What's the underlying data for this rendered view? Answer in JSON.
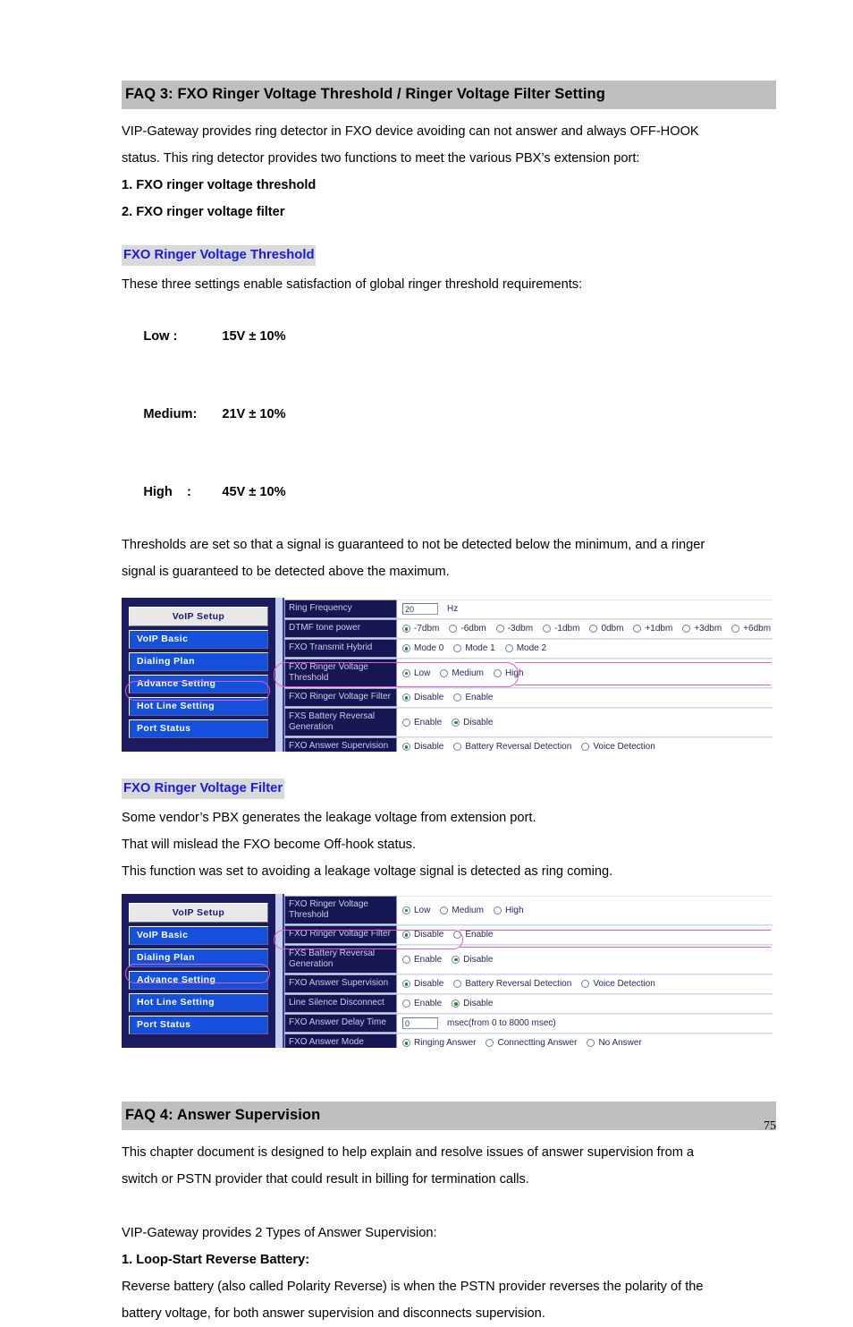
{
  "page": {
    "number": "75"
  },
  "faq3": {
    "banner": "FAQ 3: FXO Ringer Voltage Threshold / Ringer Voltage Filter Setting",
    "intro_line1": "VIP-Gateway provides ring detector in FXO device avoiding can not answer and always OFF-HOOK",
    "intro_line2": "status. This ring detector provides two functions to meet the various PBX’s extension port:",
    "list": [
      "1. FXO ringer voltage threshold",
      "2. FXO ringer voltage filter"
    ],
    "threshold": {
      "subhead": "FXO Ringer Voltage Threshold",
      "lead": "These three settings enable satisfaction of global ringer threshold requirements:",
      "rows": [
        {
          "label": "Low :",
          "value": "15V ± 10%"
        },
        {
          "label": "Medium:",
          "value": "21V ± 10%"
        },
        {
          "label": "High    :",
          "value": "45V ± 10%"
        }
      ],
      "note_line1": "Thresholds are set so that a signal is guaranteed to not be detected below the minimum, and a ringer",
      "note_line2": "signal is guaranteed to be detected above the maximum."
    },
    "filter": {
      "subhead": "FXO Ringer Voltage Filter",
      "line1": "Some vendor’s PBX generates the leakage voltage from extension port.",
      "line2": "That will mislead the FXO become Off-hook status.",
      "line3": "This function was set to avoiding a leakage voltage signal is detected as ring coming."
    }
  },
  "faq4": {
    "banner": "FAQ 4: Answer Supervision",
    "line1": "This chapter document is designed to help explain and resolve issues of answer supervision from a",
    "line2": "switch or PSTN provider that could result in billing for termination calls.",
    "line3": "VIP-Gateway provides 2 Types of Answer Supervision:",
    "heading_1": "1. Loop-Start Reverse Battery:",
    "line4": "Reverse battery (also called Polarity Reverse) is when the PSTN provider reverses the polarity of the",
    "line5": "battery voltage, for both answer supervision and disconnects supervision."
  },
  "screenshot1": {
    "sidebar": {
      "header": "VoIP Setup",
      "items": [
        {
          "label": "VoIP Basic",
          "highlighted": false
        },
        {
          "label": "Dialing Plan",
          "highlighted": false
        },
        {
          "label": "Advance Setting",
          "highlighted": true
        },
        {
          "label": "Hot Line Setting",
          "highlighted": false
        },
        {
          "label": "Port Status",
          "highlighted": false
        }
      ]
    },
    "rows": [
      {
        "label": "Ring Frequency",
        "type": "text",
        "value": "20",
        "unit": "Hz"
      },
      {
        "label": "DTMF tone power",
        "type": "radio",
        "options": [
          "-7dbm",
          "-6dbm",
          "-3dbm",
          "-1dbm",
          "0dbm",
          "+1dbm",
          "+3dbm",
          "+6dbm"
        ],
        "selected": 0
      },
      {
        "label": "FXO Transmit Hybrid",
        "type": "radio",
        "options": [
          "Mode 0",
          "Mode 1",
          "Mode 2"
        ],
        "selected": 0
      },
      {
        "label": "FXO Ringer Voltage Threshold",
        "type": "radio",
        "options": [
          "Low",
          "Medium",
          "High"
        ],
        "selected": 0
      },
      {
        "label": "FXO Ringer Voltage Filter",
        "type": "radio",
        "options": [
          "Disable",
          "Enable"
        ],
        "selected": 0
      },
      {
        "label": "FXS Battery Reversal Generation",
        "type": "radio",
        "options": [
          "Enable",
          "Disable"
        ],
        "selected": 1
      },
      {
        "label": "FXO Answer Supervision",
        "type": "radio",
        "options": [
          "Disable",
          "Battery Reversal Detection",
          "Voice Detection"
        ],
        "selected": 0
      }
    ]
  },
  "screenshot2": {
    "sidebar": {
      "header": "VoIP Setup",
      "items": [
        {
          "label": "VoIP Basic",
          "highlighted": false
        },
        {
          "label": "Dialing Plan",
          "highlighted": false
        },
        {
          "label": "Advance Setting",
          "highlighted": true
        },
        {
          "label": "Hot Line Setting",
          "highlighted": false
        },
        {
          "label": "Port Status",
          "highlighted": false
        }
      ]
    },
    "rows": [
      {
        "label": "FXO Ringer Voltage Threshold",
        "type": "radio",
        "options": [
          "Low",
          "Medium",
          "High"
        ],
        "selected": 0
      },
      {
        "label": "FXO Ringer Voltage Filter",
        "type": "radio",
        "options": [
          "Disable",
          "Enable"
        ],
        "selected": 0
      },
      {
        "label": "FXS Battery Reversal Generation",
        "type": "radio",
        "options": [
          "Enable",
          "Disable"
        ],
        "selected": 1
      },
      {
        "label": "FXO Answer Supervision",
        "type": "radio",
        "options": [
          "Disable",
          "Battery Reversal Detection",
          "Voice Detection"
        ],
        "selected": 0
      },
      {
        "label": "Line Silence Disconnect",
        "type": "radio",
        "options": [
          "Enable",
          "Disable"
        ],
        "selected": 1
      },
      {
        "label": "FXO Answer Delay Time",
        "type": "text",
        "value": "0",
        "unit": "msec(from 0 to 8000 msec)"
      },
      {
        "label": "FXO Answer Mode",
        "type": "radio",
        "options": [
          "Ringing Answer",
          "Connectting Answer",
          "No Answer"
        ],
        "selected": 0
      }
    ]
  },
  "colors": {
    "banner_bg": "#bfbfbf",
    "subhead_text": "#1919e6",
    "shot_bg": "#1b1b5e",
    "nav_btn": "#1550dd",
    "highlight_pink": "#e05ad0",
    "radio_selected": "#1f8b1f"
  }
}
